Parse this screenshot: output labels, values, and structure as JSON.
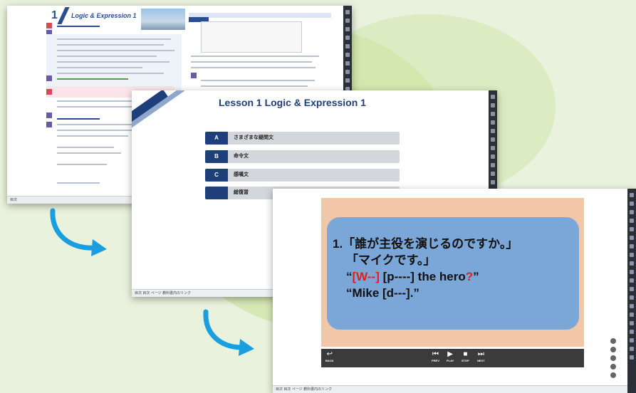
{
  "screen1": {
    "unit_number": "1",
    "title": "Logic & Expression 1",
    "taskbar_text": "目次"
  },
  "screen2": {
    "lesson_title": "Lesson 1   Logic & Expression 1",
    "menu": [
      {
        "tag": "A",
        "label": "さまざまな疑問文"
      },
      {
        "tag": "B",
        "label": "命令文"
      },
      {
        "tag": "C",
        "label": "感嘆文"
      },
      {
        "tag": "",
        "label": "総復習"
      }
    ],
    "taskbar_text": "目次 目次 ページ 教科書内のリンク"
  },
  "screen3": {
    "question_line1": "1.「誰が主役を演じるのですか。」",
    "question_line2": "「マイクです。」",
    "question_line3_open": "“",
    "question_line3_blank": "[W--]",
    "question_line3_mid": " [p----] the hero",
    "question_line3_q": "?",
    "question_line3_close": "”",
    "question_line4": "“Mike [d---].”",
    "controls": {
      "back": "BACK",
      "prev": "PREV",
      "play": "PLAY",
      "stop": "STOP",
      "next": "NEXT"
    },
    "taskbar_text": "目次 目次 ページ 教科書内のリンク"
  },
  "colors": {
    "background": "#e9f2dc",
    "navy": "#1f3f7a",
    "stage": "#f1c6a9",
    "card": "#7ba6d8",
    "arrow": "#1a9ee0"
  }
}
